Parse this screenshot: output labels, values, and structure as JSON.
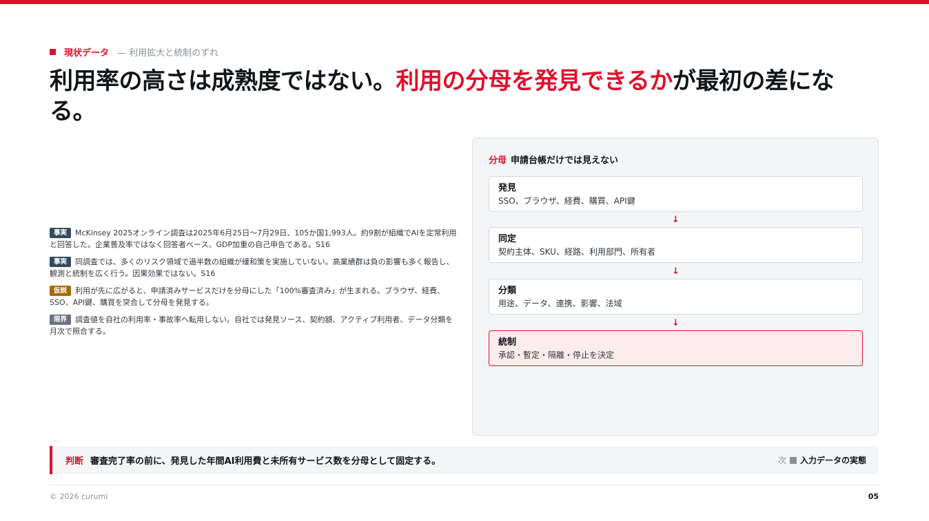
{
  "kicker": {
    "main": "現状データ",
    "sub": "— 利用拡大と統制のずれ"
  },
  "title": {
    "part1": "利用率の高さは成熟度ではない。",
    "highlight": "利用の分母を発見できるか",
    "part2": "が最初の差になる。"
  },
  "notes": [
    {
      "tag": "事実",
      "text": "McKinsey 2025オンライン調査は2025年6月25日〜7月29日、105か国1,993人。約9割が組織でAIを定常利用と回答した。企業普及率ではなく回答者ベース、GDP加重の自己申告である。S16"
    },
    {
      "tag": "事実",
      "text": "同調査では、多くのリスク領域で過半数の組織が緩和策を実施していない。高業績群は負の影響も多く報告し、観測と統制を広く行う。因果効果ではない。S16"
    },
    {
      "tag": "仮説",
      "text": "利用が先に広がると、申請済みサービスだけを分母にした「100%審査済み」が生まれる。ブラウザ、経費、SSO、API鍵、購買を突合して分母を発見する。"
    },
    {
      "tag": "限界",
      "text": "調査値を自社の利用率・事故率へ転用しない。自社では発見ソース、契約額、アクティブ利用者、データ分類を月次で照合する。"
    }
  ],
  "panel": {
    "head_accent": "分母",
    "head_text": "申請台帳だけでは見えない",
    "arrow_glyph": "↓",
    "steps": [
      {
        "title": "発見",
        "desc": "SSO、ブラウザ、経費、購買、API鍵"
      },
      {
        "title": "同定",
        "desc": "契約主体、SKU、経路、利用部門、所有者"
      },
      {
        "title": "分類",
        "desc": "用途、データ、連携、影響、法域"
      },
      {
        "title": "統制",
        "desc": "承認・暫定・隔離・停止を決定"
      }
    ]
  },
  "decision": {
    "label": "判断",
    "text": "審査完了率の前に、発見した年間AI利用費と未所有サービス数を分母として固定する。",
    "next_word": "次",
    "next_label": "入力データの実態"
  },
  "footer": {
    "copyright": "© 2026 curumi",
    "page": "05"
  },
  "colors": {
    "accent": "#e0102a",
    "fact_tag": "#354a5e",
    "hypothesis_tag": "#a36c0b",
    "limit_tag": "#6b7280"
  }
}
